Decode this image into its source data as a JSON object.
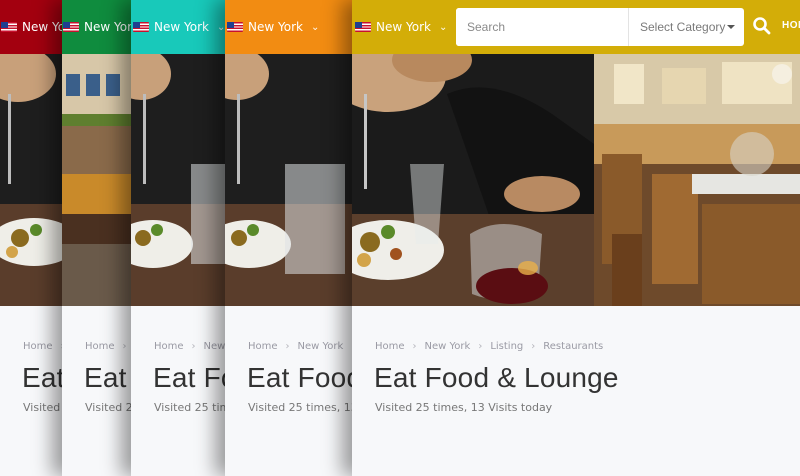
{
  "colors": {
    "card1": "#a3000f",
    "card2": "#0f8c3e",
    "card3": "#18c9ba",
    "card4": "#f28c12",
    "card5": "#d3ad08"
  },
  "location": {
    "city": "New York",
    "dropdown_icon": "chevron-down-icon",
    "flag_icon": "us-flag-icon"
  },
  "search": {
    "placeholder": "Search",
    "category_label": "Select Category",
    "button_icon": "search-icon"
  },
  "nav": {
    "home": "HOME"
  },
  "breadcrumb": {
    "home": "Home",
    "city": "New York",
    "section": "Listing",
    "category": "Restaurants",
    "separator_icon": "chevron-right-icon"
  },
  "listing": {
    "title": "Eat Food & Lounge",
    "visits": "Visited 25 times, 13 Visits today"
  }
}
